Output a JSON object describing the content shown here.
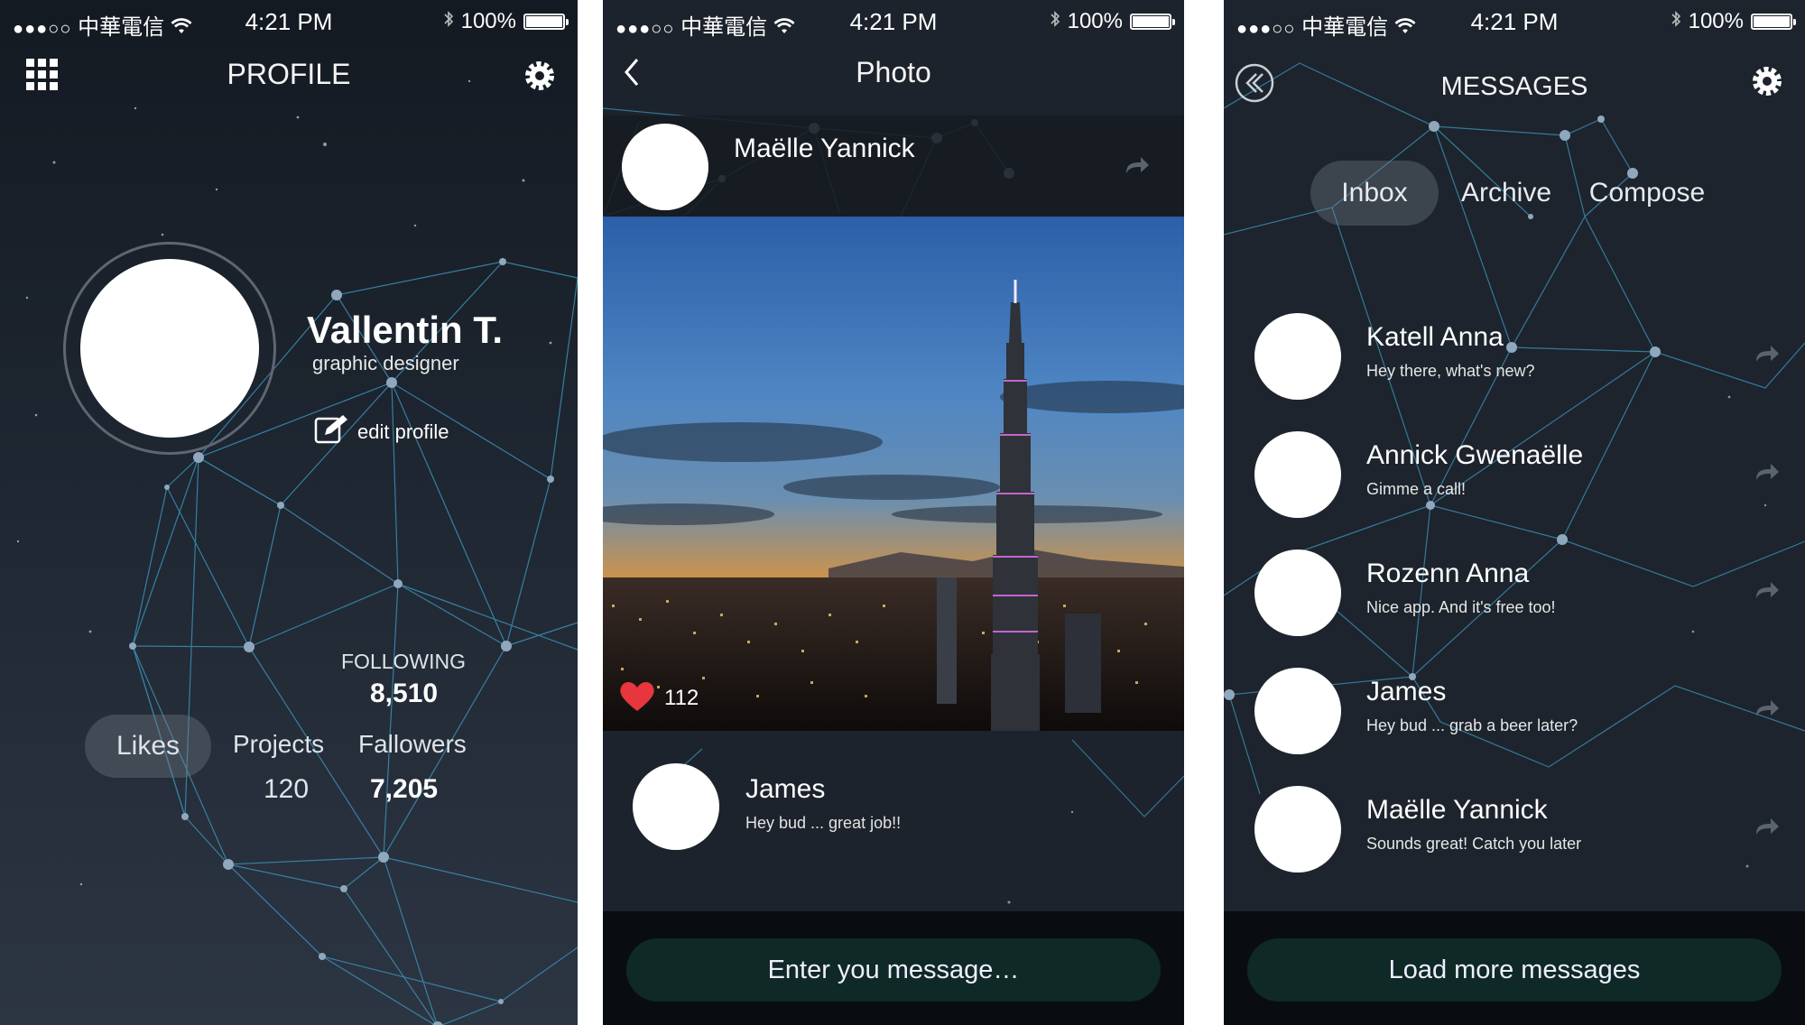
{
  "status_bar": {
    "signal": "●●●○○",
    "carrier": "中華電信",
    "time": "4:21 PM",
    "battery": "100%",
    "battery_level": 1.0
  },
  "profile_screen": {
    "title": "PROFILE",
    "name": "Vallentin T.",
    "role": "graphic designer",
    "edit_label": "edit profile",
    "following_label": "FOLLOWING",
    "following_value": "8,510",
    "tab_likes": "Likes",
    "projects_label": "Projects",
    "projects_value": "120",
    "followers_label": "Fallowers",
    "followers_value": "7,205",
    "icons": [
      "grid-menu-icon",
      "gear-icon",
      "edit-icon"
    ]
  },
  "photo_screen": {
    "title": "Photo",
    "author": "Maëlle Yannick",
    "likes": "112",
    "comment": {
      "name": "James",
      "text": "Hey bud ... great job!!"
    },
    "input_placeholder": "Enter you message…",
    "icons": [
      "back-chevron-icon",
      "share-arrow-icon",
      "heart-icon"
    ]
  },
  "messages_screen": {
    "title": "MESSAGES",
    "tabs": [
      {
        "label": "Inbox"
      },
      {
        "label": "Archive"
      },
      {
        "label": "Compose"
      }
    ],
    "messages": [
      {
        "name": "Katell Anna",
        "text": "Hey there, what's new?"
      },
      {
        "name": "Annick Gwenaëlle",
        "text": "Gimme a call!"
      },
      {
        "name": "Rozenn Anna",
        "text": "Nice app. And it's free too!"
      },
      {
        "name": "James",
        "text": "Hey bud ... grab a beer later?"
      },
      {
        "name": "Maëlle Yannick",
        "text": "Sounds great! Catch you later"
      }
    ],
    "load_more": "Load more messages",
    "icons": [
      "back-circle-icon",
      "gear-icon",
      "reply-arrow-icon"
    ]
  },
  "colors": {
    "network_line": "#3b8fb5",
    "network_node": "#8fa8bd",
    "like": "#e8363f",
    "pill": "#0f2927"
  }
}
